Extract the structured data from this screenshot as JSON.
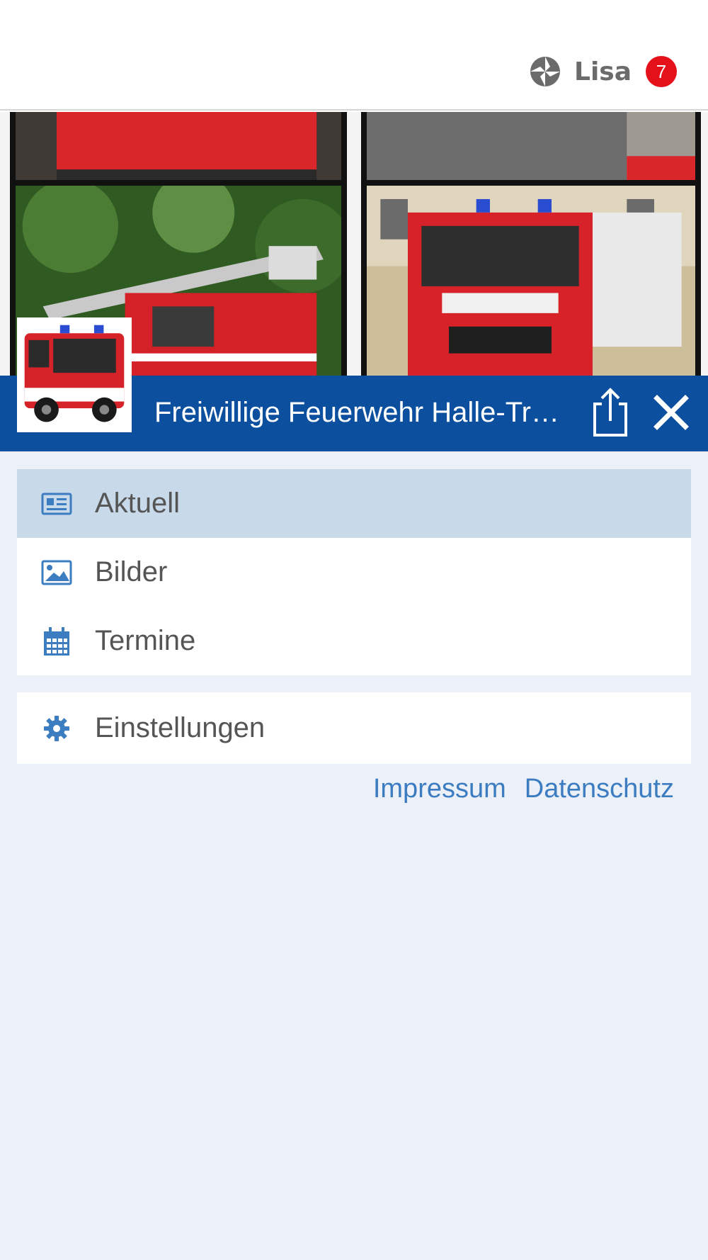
{
  "header": {
    "user_name": "Lisa",
    "notification_count": "7",
    "logo_icon": "app-logo-icon"
  },
  "banner": {
    "title": "Freiwillige Feuerwehr Halle-Tr…",
    "share_icon": "share-icon",
    "close_icon": "close-icon"
  },
  "menu": {
    "items": [
      {
        "label": "Aktuell",
        "icon": "newspaper-icon",
        "active": true
      },
      {
        "label": "Bilder",
        "icon": "image-icon",
        "active": false
      },
      {
        "label": "Termine",
        "icon": "calendar-icon",
        "active": false
      }
    ],
    "settings": {
      "label": "Einstellungen",
      "icon": "gear-icon"
    }
  },
  "footer_links": {
    "impressum": "Impressum",
    "datenschutz": "Datenschutz"
  },
  "colors": {
    "brand_blue": "#0b4f9e",
    "active_item": "#c8d9ea",
    "background": "#ecf0f8",
    "link": "#3c7cc0",
    "badge": "#e4111b"
  }
}
